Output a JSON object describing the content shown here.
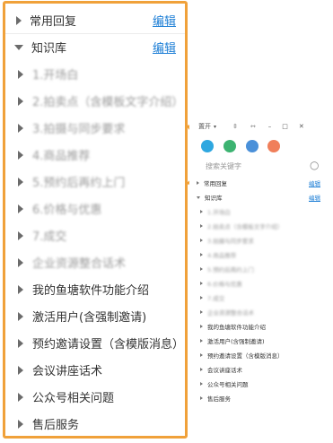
{
  "zoom_panel": {
    "sections": [
      {
        "label": "常用回复",
        "edit": "编辑",
        "expanded": false
      },
      {
        "label": "知识库",
        "edit": "编辑",
        "expanded": true
      }
    ],
    "items": [
      {
        "label": "1.开场白",
        "blurred": true
      },
      {
        "label": "2.拍卖点（含模板文字介绍）",
        "blurred": true
      },
      {
        "label": "3.拍摄与同步要求",
        "blurred": true
      },
      {
        "label": "4.商品推荐",
        "blurred": true
      },
      {
        "label": "5.预约后再约上门",
        "blurred": true
      },
      {
        "label": "6.价格与优惠",
        "blurred": true
      },
      {
        "label": "7.成交",
        "blurred": true
      },
      {
        "label": "企业资源整合话术",
        "blurred": true
      },
      {
        "label": "我的鱼塘软件功能介绍",
        "blurred": false
      },
      {
        "label": "激活用户(含强制邀请)",
        "blurred": false
      },
      {
        "label": "预约邀请设置（含模版消息）",
        "blurred": false
      },
      {
        "label": "会议讲座话术",
        "blurred": false
      },
      {
        "label": "公众号相关问题",
        "blurred": false
      },
      {
        "label": "售后服务",
        "blurred": false
      }
    ]
  },
  "window": {
    "titlebar": {
      "menu": "置开",
      "minimize": "–",
      "maximize": "□",
      "close": "✕"
    },
    "search_placeholder": "搜索关键字",
    "sections": [
      {
        "label": "常用回复",
        "edit": "编辑"
      },
      {
        "label": "知识库",
        "edit": "编辑"
      }
    ],
    "items": [
      "1.开场白",
      "2.拍卖点（含模板文字介绍）",
      "3.拍摄与同步要求",
      "4.商品推荐",
      "5.预约后再约上门",
      "6.价格与优惠",
      "7.成交",
      "企业资源整合话术",
      "我的鱼塘软件功能介绍",
      "激活用户(含强制邀请)",
      "预约邀请设置（含模版消息）",
      "会议讲座话术",
      "公众号相关问题",
      "售后服务"
    ]
  },
  "colors": {
    "frame": "#f0a13a",
    "link": "#1e7fd6"
  }
}
